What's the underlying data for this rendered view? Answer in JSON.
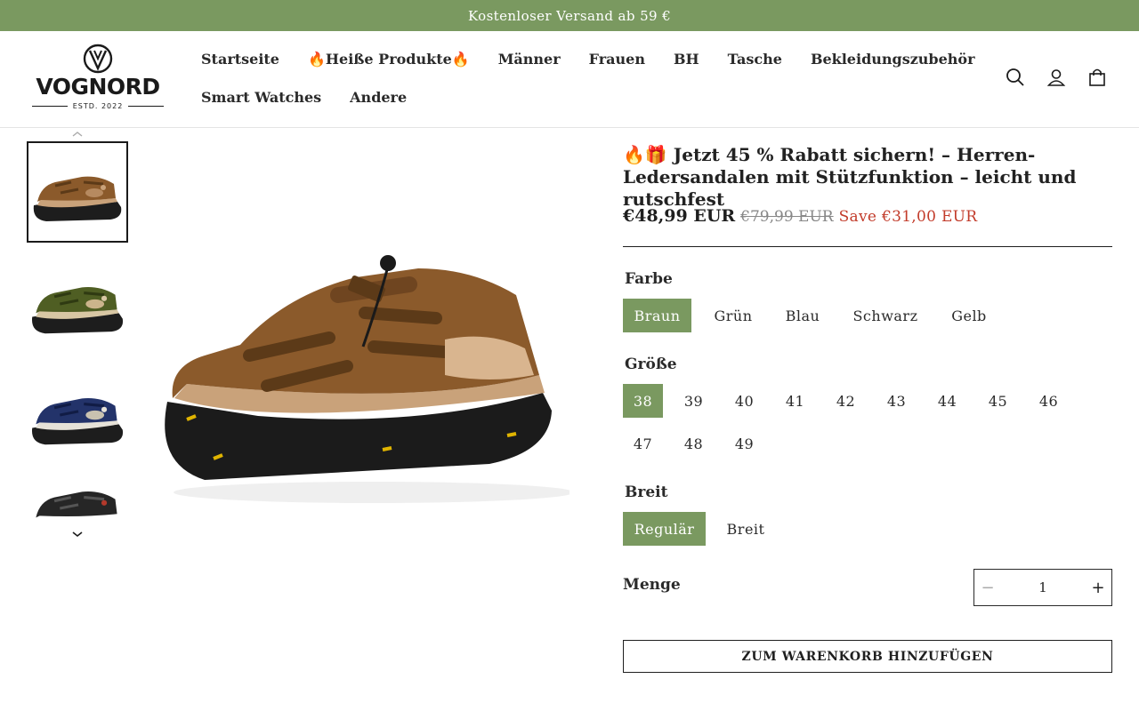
{
  "announcement": "Kostenloser Versand ab 59 €",
  "brand": {
    "name": "VOGNORD",
    "tagline": "ESTD. 2022"
  },
  "nav": {
    "row1": [
      "Startseite",
      "🔥Heiße Produkte🔥",
      "Männer",
      "Frauen",
      "BH",
      "Tasche",
      "Bekleidungszubehör"
    ],
    "row2": [
      "Smart Watches",
      "Andere"
    ]
  },
  "header_icons": [
    "search-icon",
    "account-icon",
    "cart-icon"
  ],
  "gallery": {
    "thumbnails": [
      "Braun",
      "Grün",
      "Blau",
      "Schwarz"
    ],
    "active_index": 0
  },
  "product": {
    "title": "🔥🎁 Jetzt 45 % Rabatt sichern! – Herren-Ledersandalen mit Stützfunktion – leicht und rutschfest",
    "price": "€48,99 EUR",
    "compare_price": "€79,99 EUR",
    "save": "Save  €31,00 EUR"
  },
  "options": {
    "color": {
      "label": "Farbe",
      "values": [
        "Braun",
        "Grün",
        "Blau",
        "Schwarz",
        "Gelb"
      ],
      "selected": "Braun"
    },
    "size": {
      "label": "Größe",
      "values": [
        "38",
        "39",
        "40",
        "41",
        "42",
        "43",
        "44",
        "45",
        "46",
        "47",
        "48",
        "49"
      ],
      "selected": "38"
    },
    "width": {
      "label": "Breit",
      "values": [
        "Regulär",
        "Breit"
      ],
      "selected": "Regulär"
    }
  },
  "quantity": {
    "label": "Menge",
    "value": "1",
    "minus": "−",
    "plus": "+"
  },
  "add_to_cart": "ZUM WARENKORB HINZUFÜGEN",
  "colors": {
    "accent": "#7a9960",
    "sale": "#c23b2a",
    "leather_brown": "#8b5a2b"
  }
}
